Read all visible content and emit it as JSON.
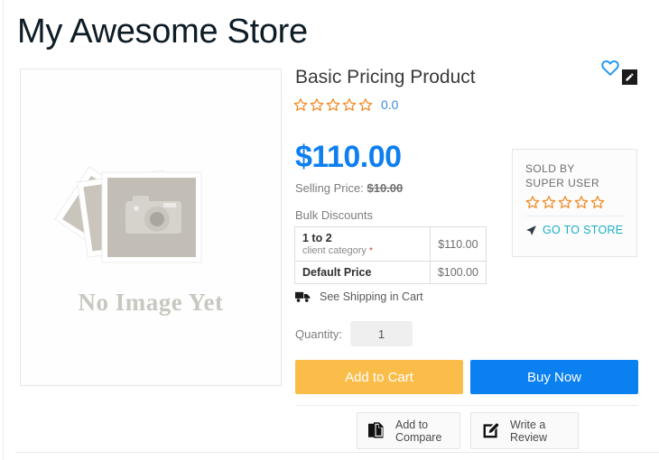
{
  "store": {
    "title": "My Awesome Store"
  },
  "gallery": {
    "placeholder_text": "No Image Yet",
    "camera_icon": "camera-icon"
  },
  "product": {
    "title": "Basic Pricing Product",
    "rating_value": "0.0",
    "rating_stars_total": 5,
    "rating_stars_filled": 0,
    "price": "$110.00",
    "selling_price_label": "Selling Price:",
    "selling_price_value": "$10.00",
    "bulk_discounts_label": "Bulk Discounts",
    "bulk_rows": [
      {
        "tier": "1 to 2",
        "sub": "client category",
        "required_mark": "*",
        "amount": "$110.00"
      },
      {
        "tier": "Default Price",
        "sub": "",
        "required_mark": "",
        "amount": "$100.00"
      }
    ],
    "shipping_note": "See Shipping in Cart",
    "quantity_label": "Quantity:",
    "quantity_value": "1",
    "quantity_placeholder": "1"
  },
  "seller": {
    "sold_by_label": "SOLD BY",
    "name": "SUPER USER",
    "stars_total": 5,
    "stars_filled": 0,
    "go_to_store_label": "GO TO STORE"
  },
  "actions": {
    "add_to_cart": "Add to Cart",
    "buy_now": "Buy Now",
    "add_to_compare_line1": "Add to",
    "add_to_compare_line2": "Compare",
    "write_review_line1": "Write a",
    "write_review_line2": "Review"
  },
  "icons": {
    "wishlist": "heart-icon",
    "edit": "pencil-edit-icon",
    "shipping": "truck-icon",
    "go_store": "navigation-arrow-icon",
    "compare": "copy-documents-icon",
    "review": "pencil-square-icon"
  },
  "colors": {
    "price_blue": "#0d7fef",
    "star_orange": "#f08a24",
    "cart_amber": "#fbbd4a",
    "buy_blue": "#0b80f0",
    "store_link_teal": "#19aec4",
    "required_red": "#e0332c"
  }
}
